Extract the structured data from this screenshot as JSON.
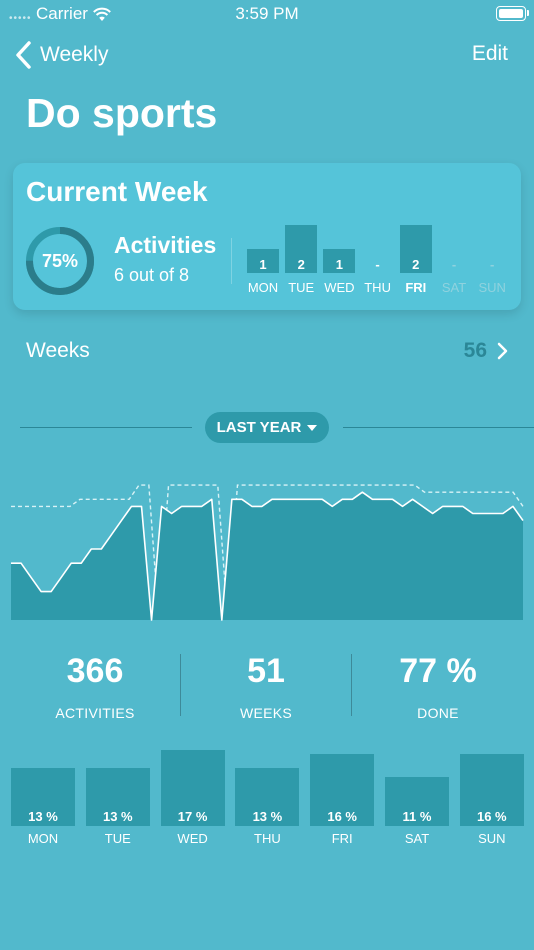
{
  "status_bar": {
    "carrier": "Carrier",
    "time": "3:59 PM"
  },
  "nav": {
    "back_label": "Weekly",
    "edit_label": "Edit"
  },
  "page_title": "Do sports",
  "current_week": {
    "title": "Current Week",
    "percent_label": "75%",
    "percent_value": 0.75,
    "activities_title": "Activities",
    "activities_sub": "6 out of 8",
    "days": [
      {
        "label": "MON",
        "value": "1",
        "count": 1,
        "active": true,
        "bold": false
      },
      {
        "label": "TUE",
        "value": "2",
        "count": 2,
        "active": true,
        "bold": false
      },
      {
        "label": "WED",
        "value": "1",
        "count": 1,
        "active": true,
        "bold": false
      },
      {
        "label": "THU",
        "value": "-",
        "count": 0,
        "active": true,
        "bold": false
      },
      {
        "label": "FRI",
        "value": "2",
        "count": 2,
        "active": true,
        "bold": true
      },
      {
        "label": "SAT",
        "value": "-",
        "count": 0,
        "active": false,
        "bold": false
      },
      {
        "label": "SUN",
        "value": "-",
        "count": 0,
        "active": false,
        "bold": false
      }
    ]
  },
  "weeks": {
    "label": "Weeks",
    "count": "56"
  },
  "range": {
    "label": "LAST YEAR"
  },
  "chart_data": {
    "type": "area",
    "ylim": [
      0,
      100
    ],
    "series": [
      {
        "values": [
          40,
          40,
          30,
          20,
          20,
          30,
          40,
          40,
          50,
          50,
          60,
          70,
          80,
          80,
          0,
          80,
          75,
          80,
          80,
          80,
          85,
          0,
          85,
          85,
          80,
          80,
          85,
          85,
          85,
          85,
          85,
          85,
          80,
          85,
          85,
          90,
          85,
          85,
          85,
          80,
          85,
          80,
          75,
          80,
          80,
          80,
          75,
          75,
          75,
          75,
          80,
          70
        ]
      },
      {
        "values": [
          80,
          80,
          80,
          80,
          80,
          80,
          80,
          85,
          85,
          85,
          85,
          85,
          85,
          95,
          95,
          0,
          95,
          95,
          95,
          95,
          95,
          95,
          0,
          95,
          95,
          95,
          95,
          95,
          95,
          95,
          95,
          95,
          95,
          95,
          95,
          95,
          95,
          95,
          95,
          95,
          95,
          95,
          90,
          90,
          90,
          90,
          90,
          90,
          90,
          90,
          90,
          90,
          80
        ]
      }
    ],
    "colors": {
      "area": "#2e9aaa",
      "line": "#ffffff",
      "dashed": "#d8f2f6"
    }
  },
  "stats": [
    {
      "value": "366",
      "label": "ACTIVITIES"
    },
    {
      "value": "51",
      "label": "WEEKS"
    },
    {
      "value": "77 %",
      "label": "DONE"
    }
  ],
  "distribution": [
    {
      "label": "MON",
      "value": "13 %",
      "pct": 13
    },
    {
      "label": "TUE",
      "value": "13 %",
      "pct": 13
    },
    {
      "label": "WED",
      "value": "17 %",
      "pct": 17
    },
    {
      "label": "THU",
      "value": "13 %",
      "pct": 13
    },
    {
      "label": "FRI",
      "value": "16 %",
      "pct": 16
    },
    {
      "label": "SAT",
      "value": "11 %",
      "pct": 11
    },
    {
      "label": "SUN",
      "value": "16 %",
      "pct": 16
    }
  ],
  "colors": {
    "background": "#52b9cc",
    "card": "#55c4d9",
    "accent": "#2e9aaa",
    "accent_dark": "#2b8797",
    "inactive_text": "#8fd2de"
  }
}
